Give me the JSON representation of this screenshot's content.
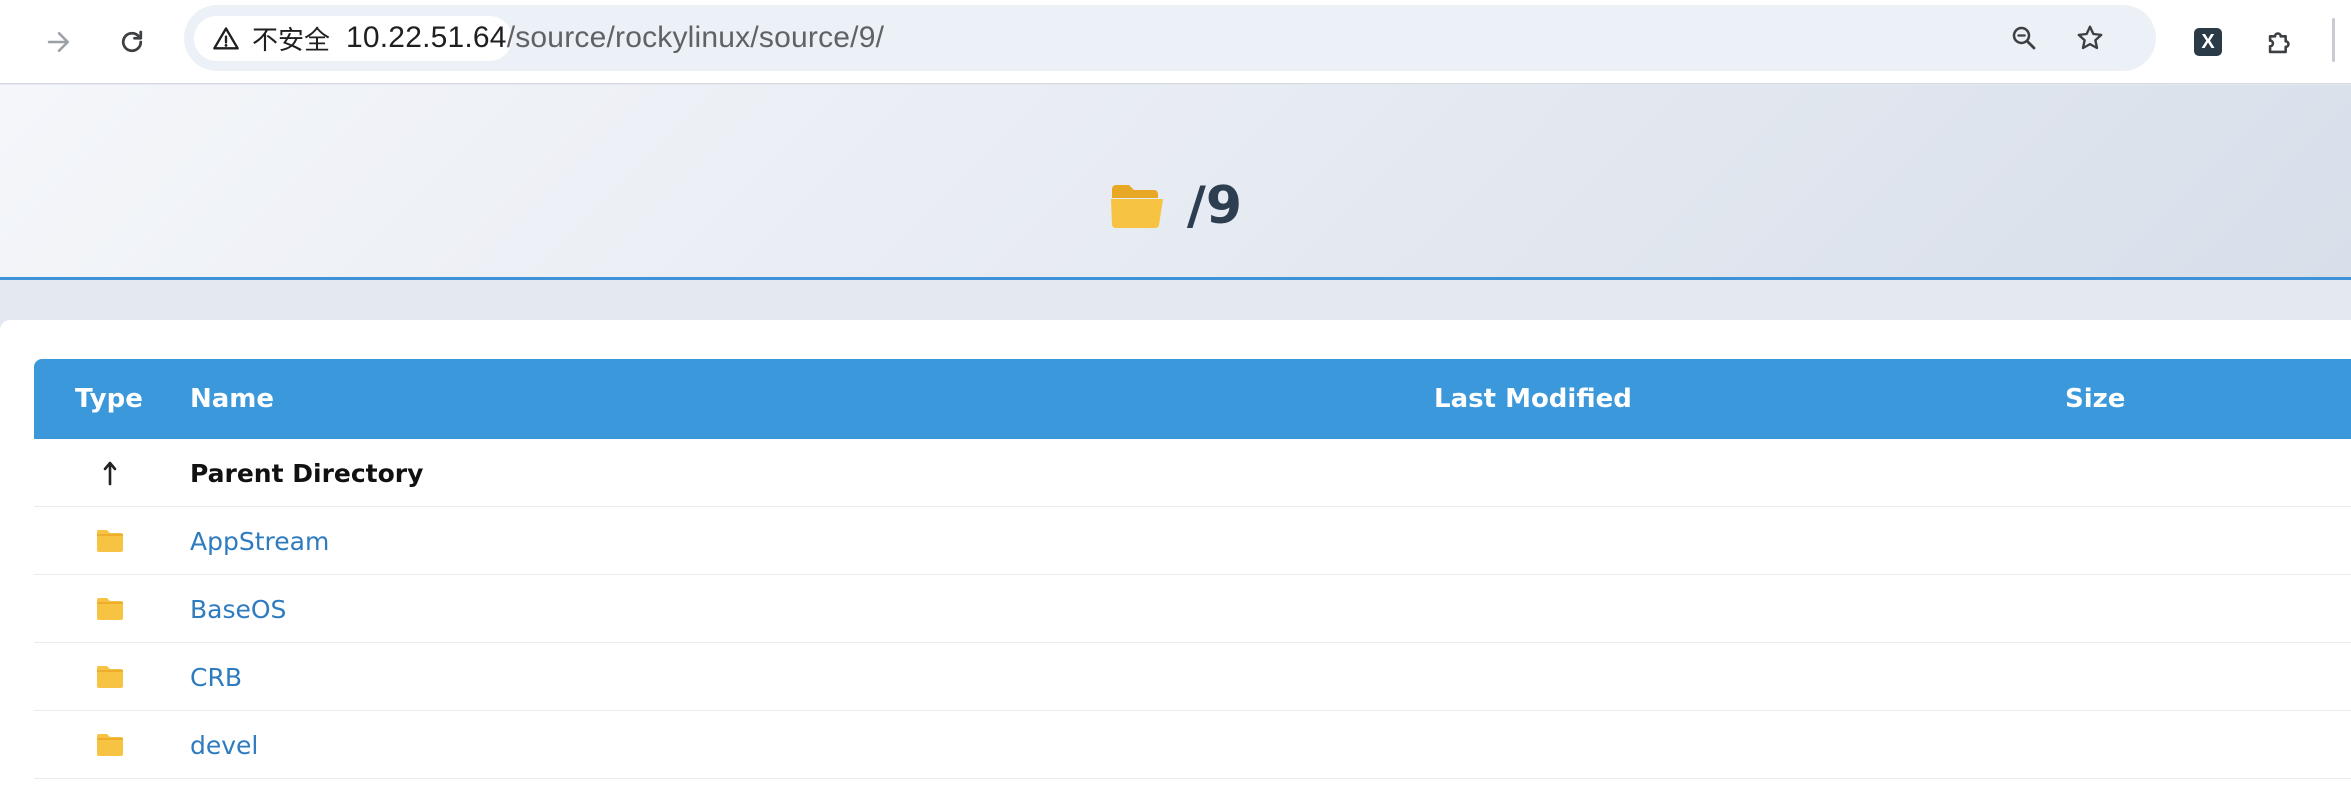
{
  "browser": {
    "security_label": "不安全",
    "url_host": "10.22.51.64",
    "url_path": "/source/rockylinux/source/9/"
  },
  "page": {
    "title": "/9"
  },
  "table": {
    "headers": {
      "type": "Type",
      "name": "Name",
      "last_modified": "Last Modified",
      "size": "Size"
    },
    "rows": [
      {
        "type_icon": "up-arrow-icon",
        "name": "Parent Directory",
        "last_modified": "",
        "size": ""
      },
      {
        "type_icon": "folder-icon",
        "name": "AppStream",
        "last_modified": "",
        "size": ""
      },
      {
        "type_icon": "folder-icon",
        "name": "BaseOS",
        "last_modified": "",
        "size": ""
      },
      {
        "type_icon": "folder-icon",
        "name": "CRB",
        "last_modified": "",
        "size": ""
      },
      {
        "type_icon": "folder-icon",
        "name": "devel",
        "last_modified": "",
        "size": ""
      }
    ]
  },
  "colors": {
    "header_bg": "#3a98db",
    "link": "#2e7bbf",
    "folder": "#f6c343",
    "title": "#2c3e50"
  }
}
